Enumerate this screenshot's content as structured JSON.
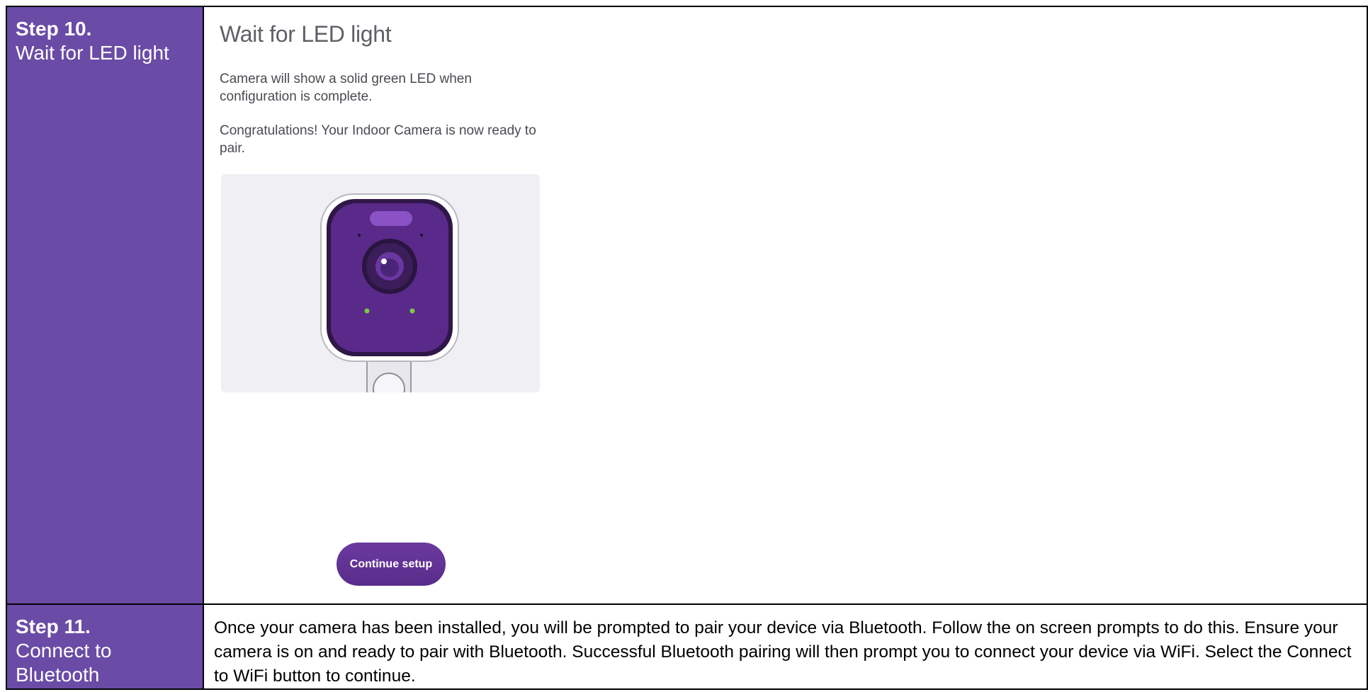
{
  "steps": [
    {
      "number": "Step 10.",
      "title": "Wait for LED light",
      "screen": {
        "title": "Wait for LED light",
        "paragraph1": "Camera will show a solid green LED when configuration is complete.",
        "paragraph2": "Congratulations! Your Indoor Camera is now ready to pair.",
        "illustration_icon": "indoor-camera-illustration",
        "button_label": "Continue setup"
      }
    },
    {
      "number": "Step 11.",
      "title": "Connect to Bluetooth",
      "description": "Once your camera has been installed, you will be prompted to pair your device via Bluetooth. Follow the on screen prompts to do this. Ensure your camera is on and ready to pair with Bluetooth. Successful Bluetooth pairing will then prompt you to connect your device via WiFi. Select the Connect to WiFi button to continue."
    }
  ],
  "colors": {
    "step_column_bg": "#6a4ba6",
    "button_bg": "#612f95",
    "camera_body": "#5a2a8a",
    "led_green": "#7ac943",
    "illustration_bg": "#f0eff4"
  }
}
